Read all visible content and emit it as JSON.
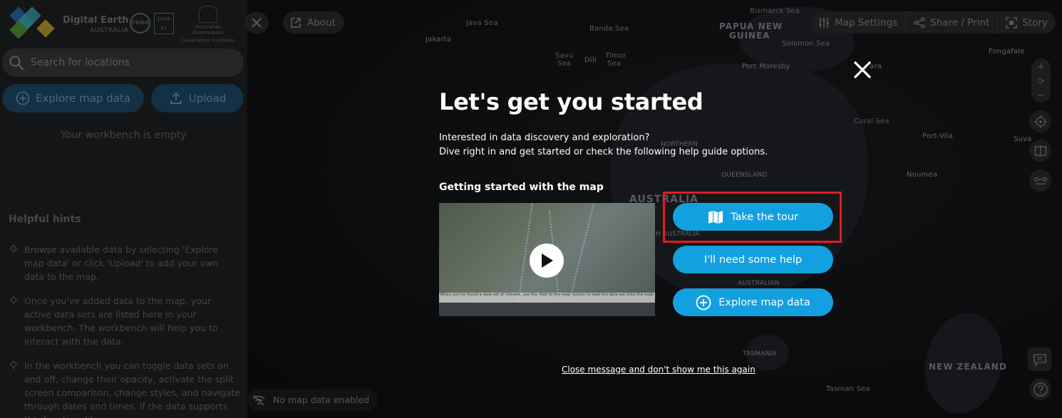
{
  "sidebar": {
    "brand": {
      "name": "Digital Earth",
      "region": "AUSTRALIA",
      "partner1": "CSIRO",
      "partner2": "DATA 61",
      "gov_line1": "Australian Government",
      "gov_line2": "Geoscience Australia"
    },
    "search": {
      "placeholder": "Search for locations",
      "value": ""
    },
    "explore_label": "Explore map data",
    "upload_label": "Upload",
    "workbench_empty": "Your workbench is empty",
    "hints_title": "Helpful hints",
    "hints": [
      "Browse available data by selecting 'Explore map data' or click 'Upload' to add your own data to the map.",
      "Once you've added data to the map, your active data sets are listed here in your workbench. The workbench will help you to interact with the data.",
      "In the workbench you can toggle data sets on and off, change their opacity, activate the split screen comparison, change styles, and navigate through dates and times, if the data supports this functionality."
    ]
  },
  "map": {
    "about_label": "About",
    "map_settings_label": "Map Settings",
    "share_label": "Share / Print",
    "story_label": "Story",
    "no_data_label": "No map data enabled",
    "labels": {
      "bismarck": "Bismarck Sea",
      "java": "Java Sea",
      "banda": "Banda Sea",
      "jakarta": "Jakarta",
      "png": "PAPUA NEW",
      "guinea": "GUINEA",
      "solomon": "Solomon Sea",
      "fongafale": "Fongafale",
      "savu": "Savu",
      "sea1": "Sea",
      "dili": "Dili",
      "timor": "Timor",
      "sea2": "Sea",
      "moresby": "Port Moresby",
      "coral": "Coral Sea",
      "portvila": "Port-Vila",
      "suva": "Suva",
      "northern": "NORTHERN",
      "queensland": "QUEENSLAND",
      "australia": "AUSTRALIA",
      "noumea": "Noumea",
      "haustralia": "H AUSTRALIA",
      "australian": "AUSTRALIAN",
      "tasmania": "TASMANIA",
      "nz": "NEW ZEALAND",
      "tasman": "Tasman Sea",
      "ara": "ara"
    }
  },
  "modal": {
    "title": "Let's get you started",
    "desc_line1": "Interested in data discovery and exploration?",
    "desc_line2": "Dive right in and get started or check the following help guide options.",
    "subheading": "Getting started with the map",
    "video_caption": "When you've found a data set of interest, use the 'Add to the map' button to load the data set onto the map.",
    "tour_label": "Take the tour",
    "help_label": "I'll need some help",
    "explore_label": "Explore map data",
    "dismiss_label": "Close message and don't show me this again"
  },
  "colors": {
    "accent": "#13a0e0",
    "highlight": "#e11d24",
    "sidebar": "#1f2224"
  }
}
